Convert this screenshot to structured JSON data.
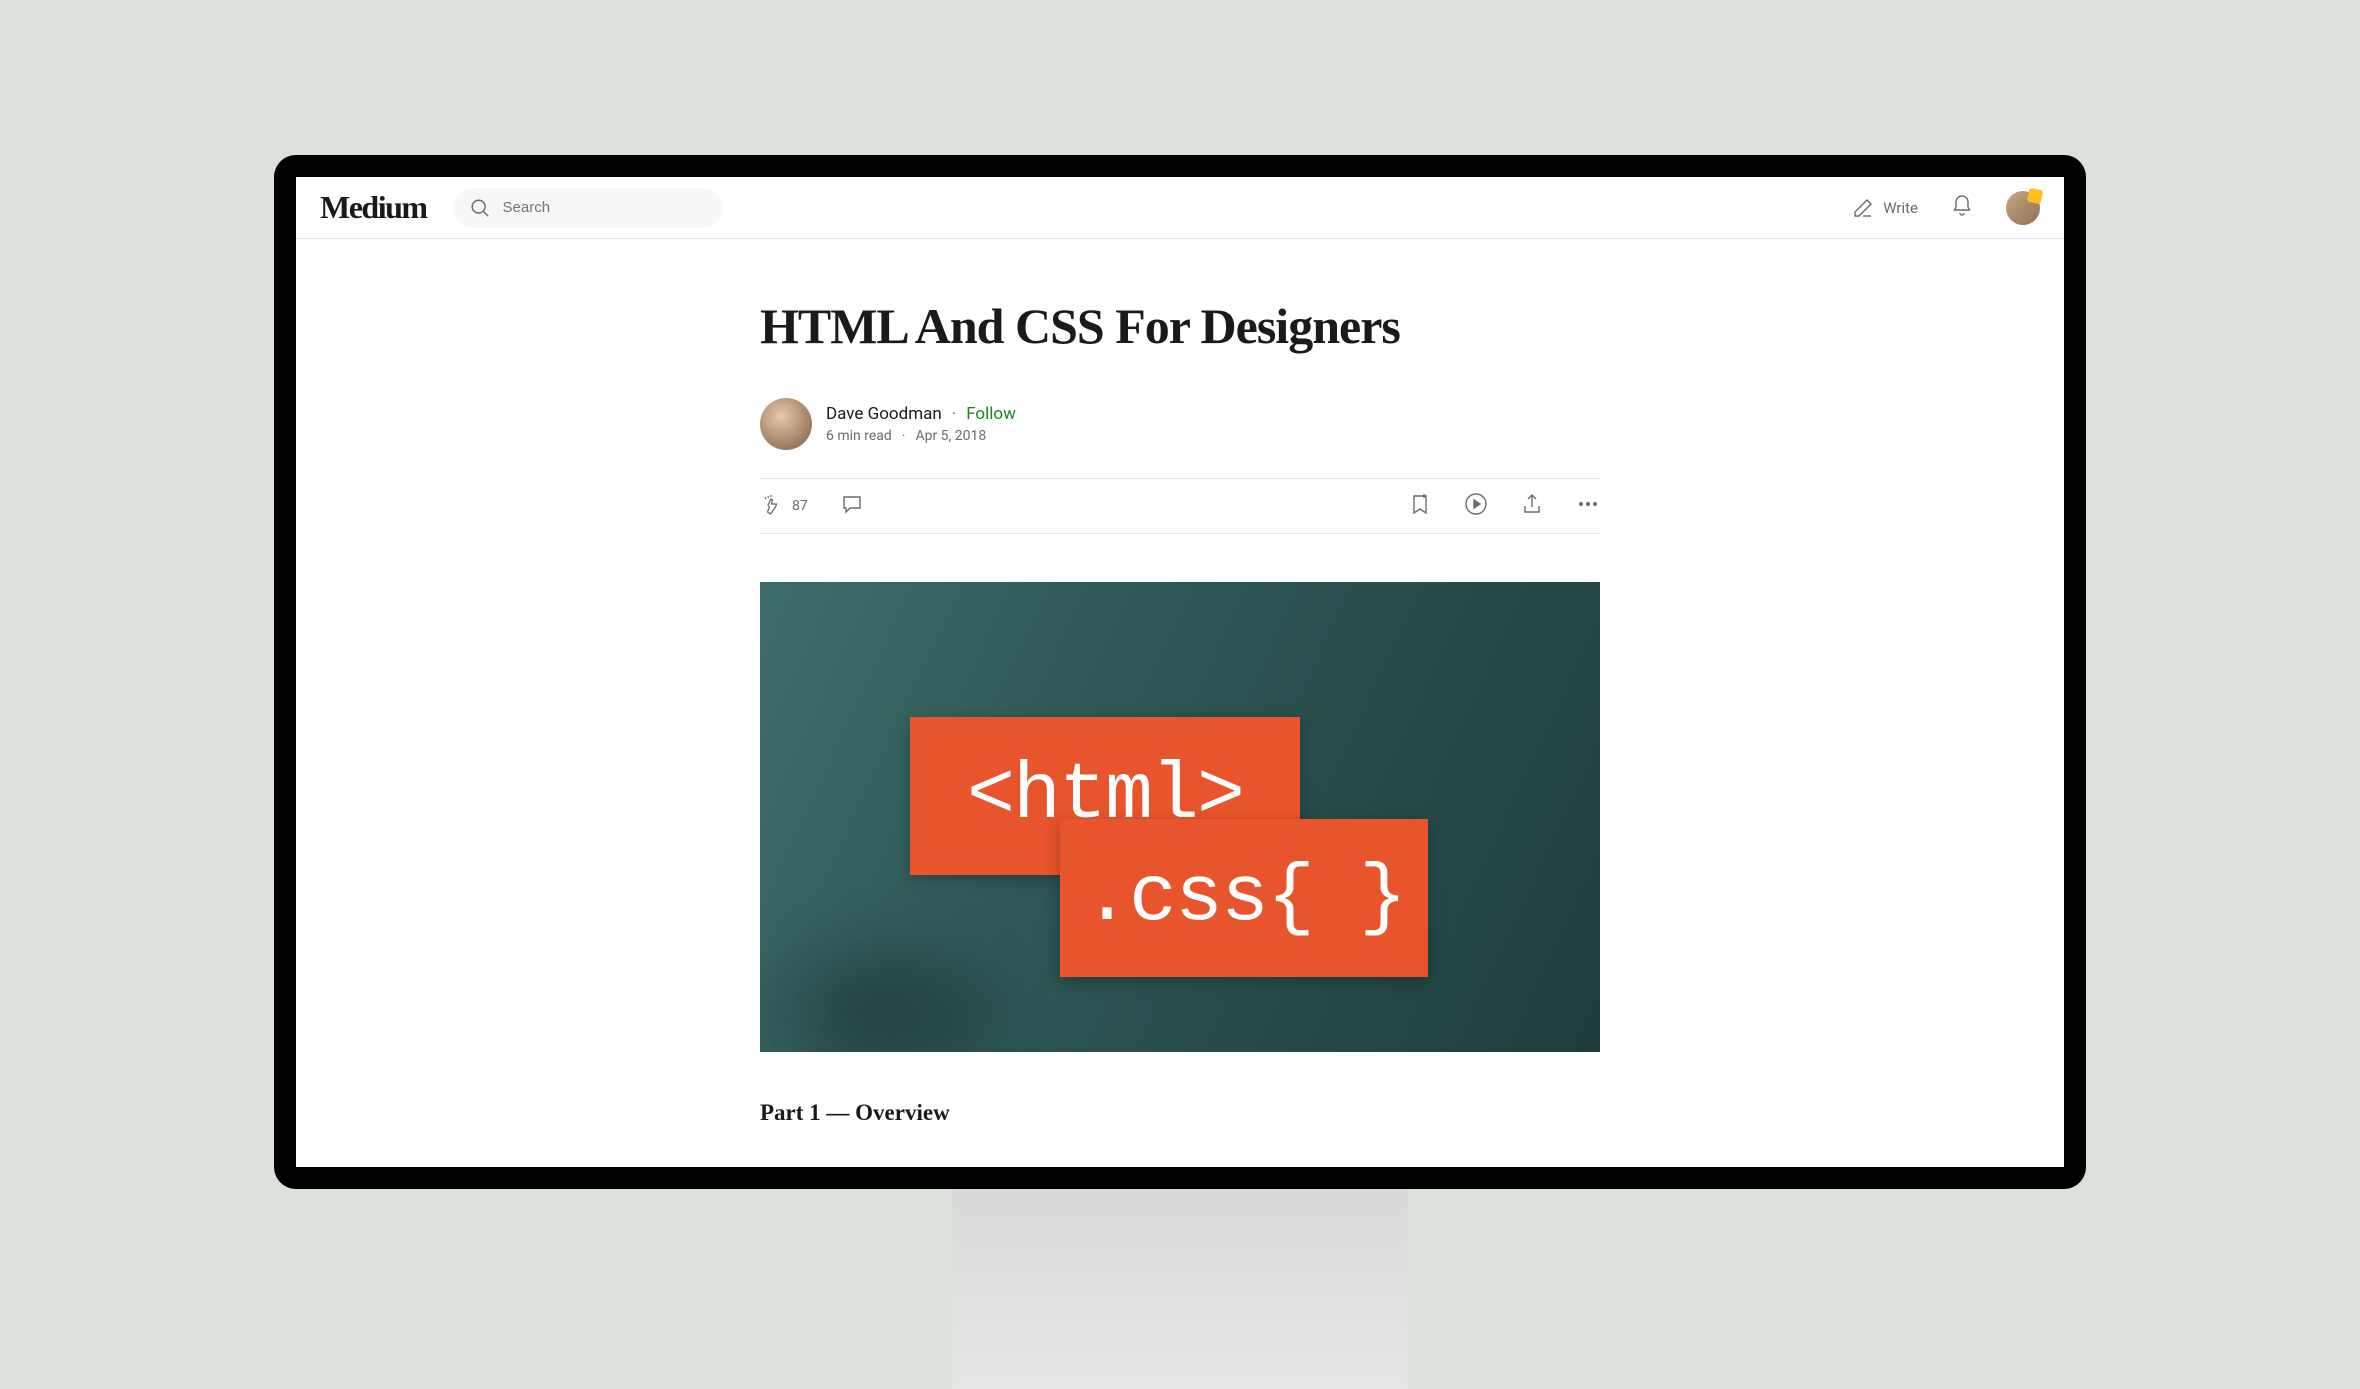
{
  "header": {
    "logo": "Medium",
    "search_placeholder": "Search",
    "write_label": "Write"
  },
  "article": {
    "title": "HTML And CSS For Designers",
    "author": "Dave Goodman",
    "follow_label": "Follow",
    "read_time": "6 min read",
    "date": "Apr 5, 2018",
    "clap_count": "87",
    "hero_tag1": "<html>",
    "hero_tag2": ".css{ }",
    "subheading": "Part 1 — Overview"
  }
}
